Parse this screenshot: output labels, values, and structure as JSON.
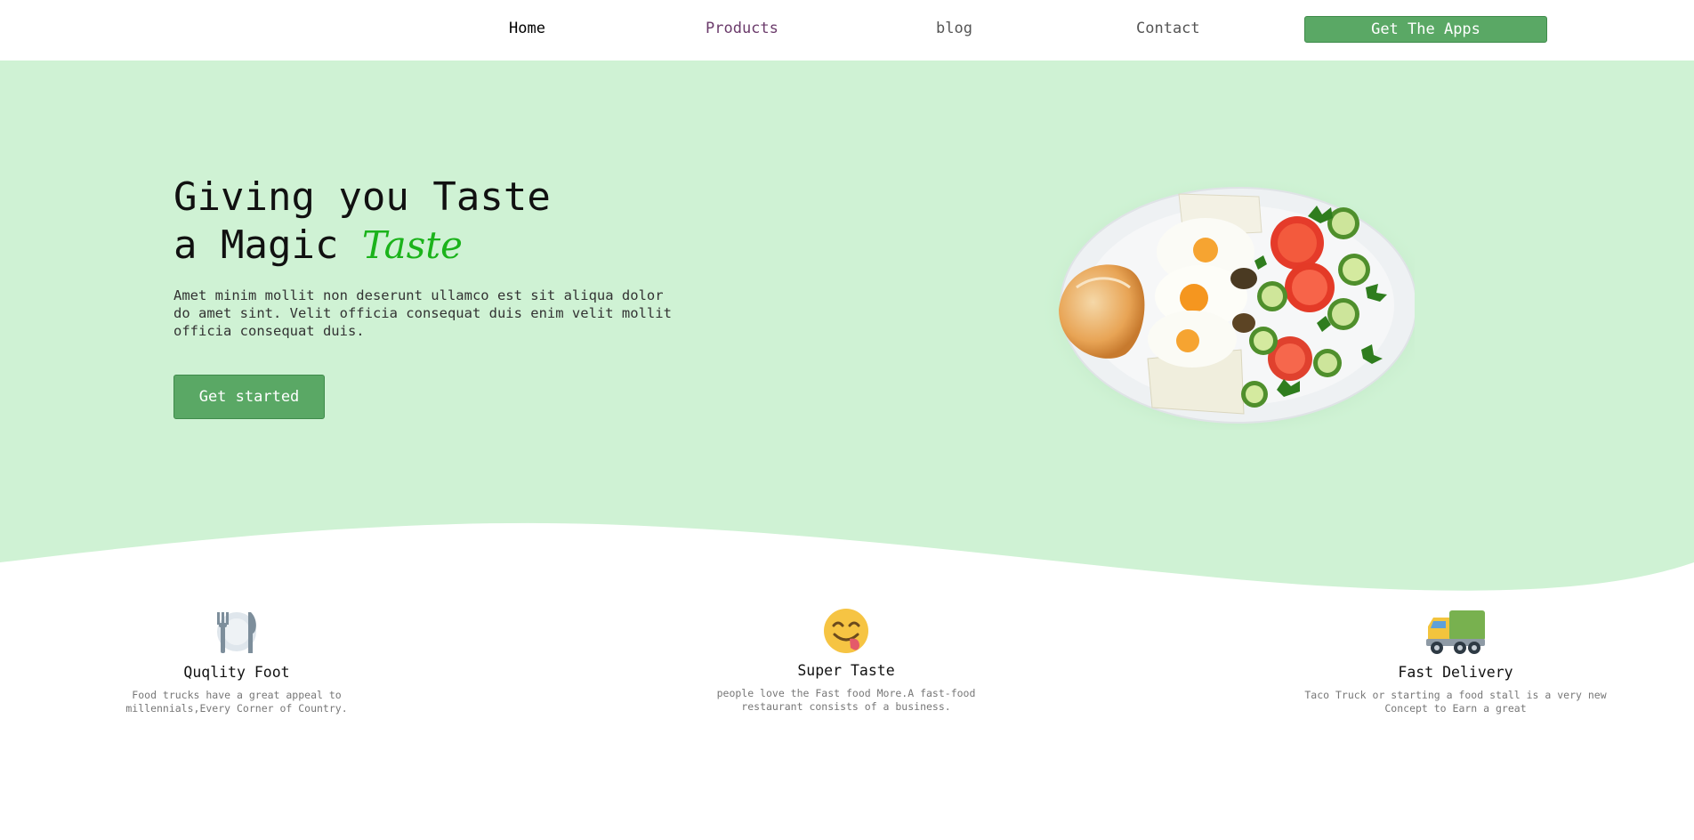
{
  "nav": {
    "items": [
      {
        "label": "Home"
      },
      {
        "label": "Products"
      },
      {
        "label": "blog"
      },
      {
        "label": "Contact"
      }
    ],
    "cta_label": "Get The Apps"
  },
  "hero": {
    "title_line1": "Giving you Taste",
    "title_line2_prefix": "a Magic ",
    "title_line2_accent": "Taste",
    "description": "Amet minim mollit non deserunt ullamco est sit aliqua dolor do amet sint. Velit officia consequat duis enim velit mollit officia consequat duis.",
    "cta_label": "Get started",
    "image_icon": "food-plate-image"
  },
  "features": [
    {
      "icon": "fork-knife-plate-icon",
      "title": "Quqlity Foot",
      "description": "Food trucks have a great appeal to millennials,Every Corner of Country."
    },
    {
      "icon": "yum-face-icon",
      "title": "Super Taste",
      "description": "people love the Fast food More.A fast-food restaurant consists of a business."
    },
    {
      "icon": "delivery-truck-icon",
      "title": "Fast Delivery",
      "description": "Taco Truck or starting a food stall is a very new Concept to Earn a great"
    }
  ],
  "colors": {
    "hero_bg": "#cff2d4",
    "accent_green": "#1bb31b",
    "button_green": "#5aa865"
  }
}
